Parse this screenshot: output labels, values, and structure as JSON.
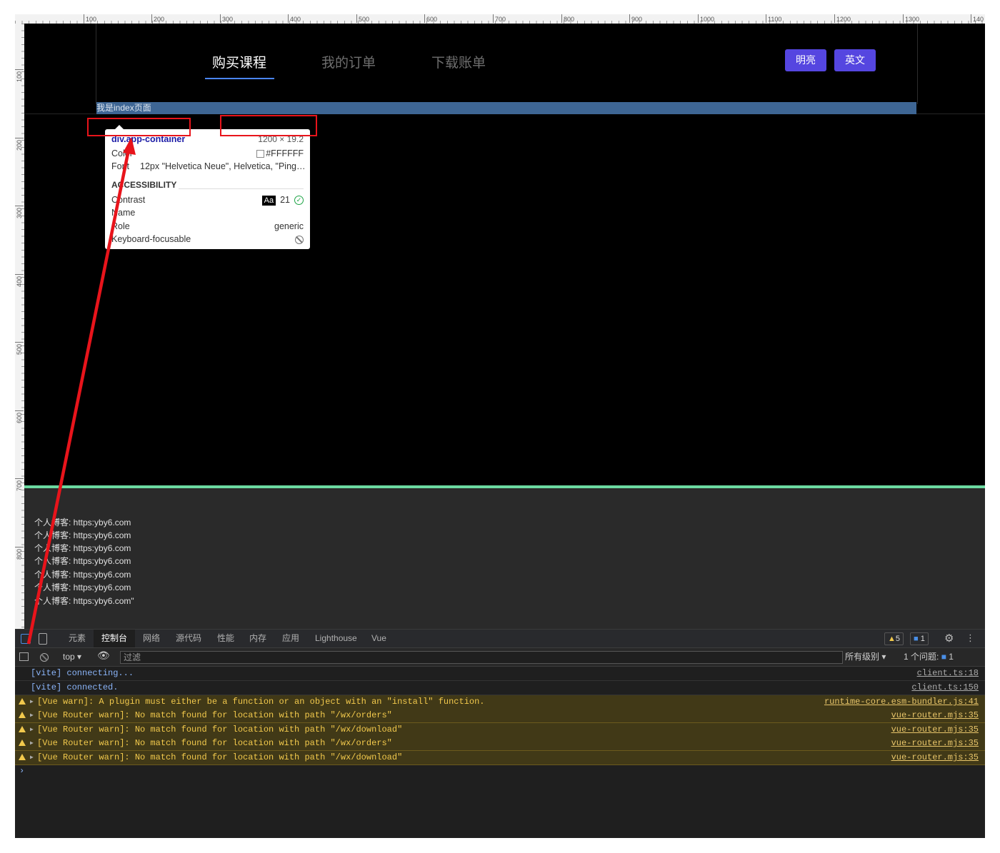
{
  "ruler": {
    "top": [
      "100",
      "200",
      "300",
      "400",
      "500",
      "600",
      "700",
      "800",
      "900",
      "1000",
      "1100",
      "1200",
      "1300",
      "140"
    ],
    "left": [
      "100",
      "200",
      "300",
      "400",
      "500",
      "600",
      "700",
      "800"
    ]
  },
  "nav": {
    "items": [
      "购买课程",
      "我的订单",
      "下载账单"
    ],
    "buttons": [
      "明亮",
      "英文"
    ]
  },
  "index_bar_text": "我是index页面",
  "tooltip": {
    "element": "div.app-container",
    "size": "1200 × 19.2",
    "color_label": "Color",
    "color_value": "#FFFFFF",
    "font_label": "Font",
    "font_value": "12px \"Helvetica Neue\", Helvetica, \"Ping…",
    "accessibility_header": "ACCESSIBILITY",
    "contrast_label": "Contrast",
    "contrast_aa": "Aa",
    "contrast_value": "21",
    "name_label": "Name",
    "role_label": "Role",
    "role_value": "generic",
    "keyboard_label": "Keyboard-focusable"
  },
  "logs": [
    "个人博客: https:yby6.com",
    "个人博客: https:yby6.com",
    "个人博客: https:yby6.com",
    "个人博客: https:yby6.com",
    "个人博客: https:yby6.com",
    "个人博客: https:yby6.com",
    "个人博客: https:yby6.com\""
  ],
  "devtools": {
    "tabs": [
      "元素",
      "控制台",
      "网络",
      "源代码",
      "性能",
      "内存",
      "应用",
      "Lighthouse",
      "Vue"
    ],
    "active_tab": "控制台",
    "warn_count": "5",
    "msg_count": "1",
    "context": "top",
    "filter_placeholder": "过滤",
    "levels": "所有级别",
    "issues": "1 个问题:",
    "issues_count": "1"
  },
  "console": [
    {
      "type": "info",
      "msg": "[vite] connecting...",
      "src": "client.ts:18"
    },
    {
      "type": "info",
      "msg": "[vite] connected.",
      "src": "client.ts:150"
    },
    {
      "type": "warn",
      "msg": "[Vue warn]: A plugin must either be a function or an object with an \"install\" function.",
      "src": "runtime-core.esm-bundler.js:41"
    },
    {
      "type": "warn",
      "msg": "[Vue Router warn]: No match found for location with path \"/wx/orders\"",
      "src": "vue-router.mjs:35"
    },
    {
      "type": "warn",
      "msg": "[Vue Router warn]: No match found for location with path \"/wx/download\"",
      "src": "vue-router.mjs:35"
    },
    {
      "type": "warn",
      "msg": "[Vue Router warn]: No match found for location with path \"/wx/orders\"",
      "src": "vue-router.mjs:35"
    },
    {
      "type": "warn",
      "msg": "[Vue Router warn]: No match found for location with path \"/wx/download\"",
      "src": "vue-router.mjs:35"
    }
  ],
  "colors": {
    "accent_button": "#5546e0",
    "index_bar": "#3e6694",
    "annotation_red": "#e8141b",
    "separator_green": "#6bd9a0"
  }
}
